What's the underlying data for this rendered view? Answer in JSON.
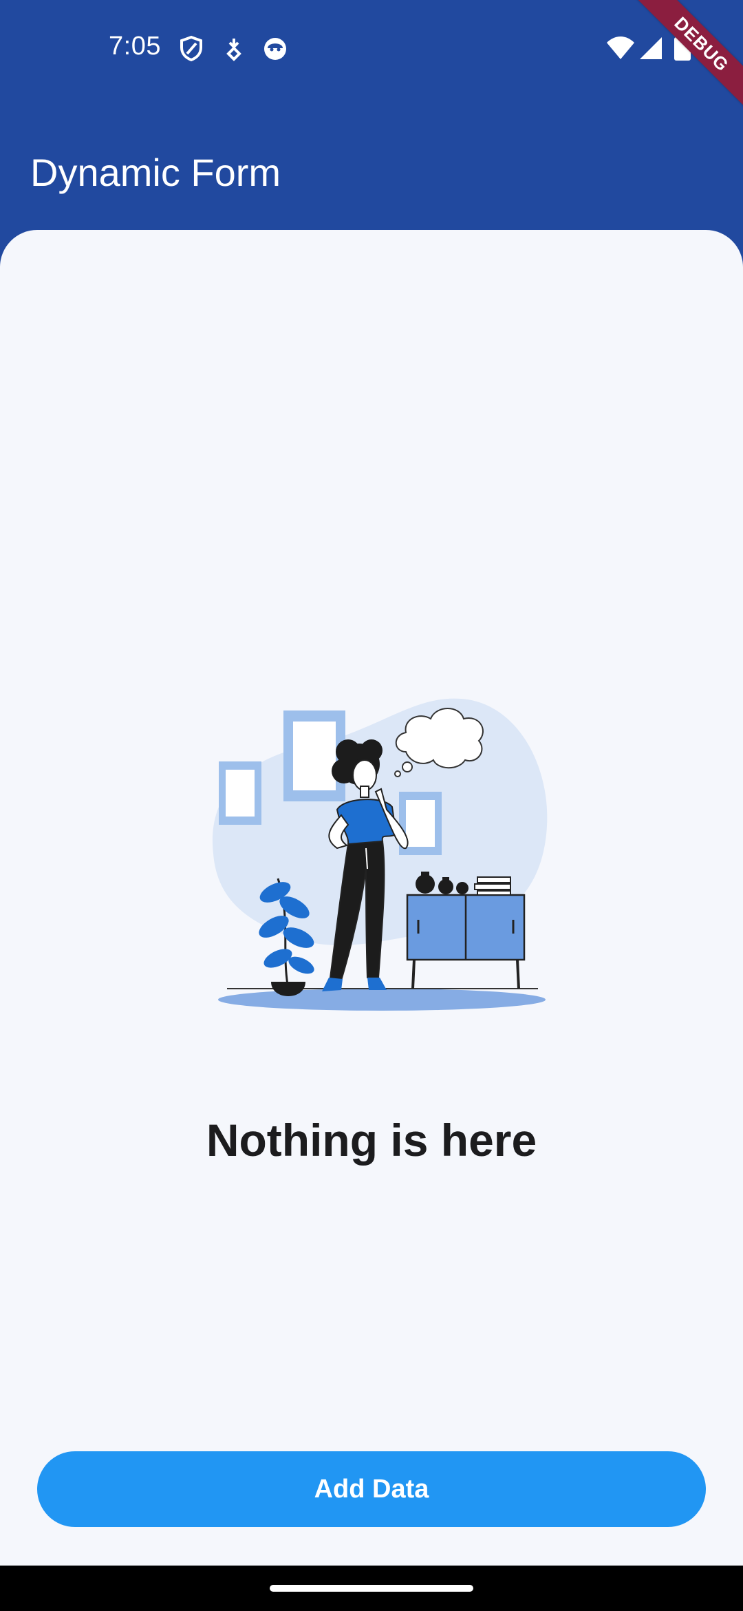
{
  "status_bar": {
    "time": "7:05",
    "icons": [
      "shield-icon",
      "download-notification-icon",
      "face-icon",
      "wifi-icon",
      "cellular-signal-icon",
      "battery-icon"
    ]
  },
  "app_bar": {
    "title": "Dynamic Form",
    "background_color": "#21499F"
  },
  "debug_banner": {
    "label": "DEBUG"
  },
  "empty_state": {
    "illustration": "person-thinking-illustration",
    "heading": "Nothing is here"
  },
  "actions": {
    "add_data_label": "Add Data",
    "accent_color": "#2196F3"
  }
}
